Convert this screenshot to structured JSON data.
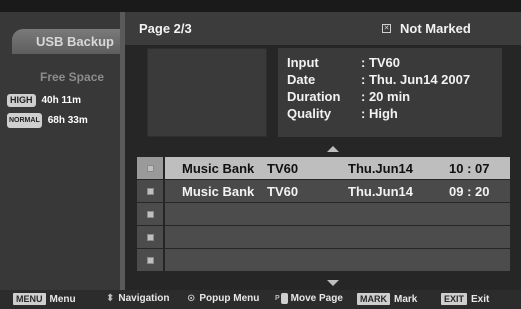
{
  "sidebar": {
    "title": "USB Backup",
    "free_space_label": "Free Space",
    "qualities": [
      {
        "badge": "HIGH",
        "time": "40h 11m"
      },
      {
        "badge": "NORMAL",
        "time": "68h 33m"
      }
    ]
  },
  "header": {
    "page": "Page 2/3",
    "mark_status": "Not Marked"
  },
  "info": {
    "fields": [
      {
        "label": "Input",
        "value": ": TV60"
      },
      {
        "label": "Date",
        "value": ": Thu. Jun14 2007"
      },
      {
        "label": "Duration",
        "value": ": 20 min"
      },
      {
        "label": "Quality",
        "value": ": High"
      }
    ]
  },
  "recordings": [
    {
      "title": "Music Bank",
      "channel": "TV60",
      "date": "Thu.Jun14",
      "time": "10 : 07",
      "selected": true
    },
    {
      "title": "Music Bank",
      "channel": "TV60",
      "date": "Thu.Jun14",
      "time": "09 : 20",
      "selected": false
    }
  ],
  "bottom_bar": {
    "menu_key": "MENU",
    "menu_label": "Menu",
    "navigation_label": "Navigation",
    "popup_label": "Popup Menu",
    "page_key": "P",
    "move_page_label": "Move Page",
    "mark_key": "MARK",
    "mark_label": "Mark",
    "exit_key": "EXIT",
    "exit_label": "Exit"
  }
}
